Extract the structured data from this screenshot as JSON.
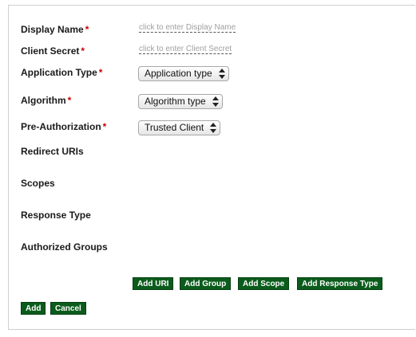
{
  "form": {
    "fields": {
      "display_name": {
        "label": "Display Name",
        "placeholder": "click to enter Display Name"
      },
      "client_secret": {
        "label": "Client Secret",
        "placeholder": "click to enter Client Secret"
      },
      "application_type": {
        "label": "Application Type",
        "value": "Application type"
      },
      "algorithm": {
        "label": "Algorithm",
        "value": "Algorithm type"
      },
      "pre_authorization": {
        "label": "Pre-Authorization",
        "value": "Trusted Client"
      }
    },
    "sections": {
      "redirect_uris": "Redirect URIs",
      "scopes": "Scopes",
      "response_type": "Response Type",
      "authorized_groups": "Authorized Groups"
    },
    "required_marker": "*",
    "buttons": {
      "add_uri": "Add URI",
      "add_group": "Add Group",
      "add_scope": "Add Scope",
      "add_response_type": "Add Response Type",
      "add": "Add",
      "cancel": "Cancel"
    }
  },
  "colors": {
    "button_bg": "#0b5c1c",
    "required": "#cc0000",
    "placeholder": "#a0a0a0"
  }
}
